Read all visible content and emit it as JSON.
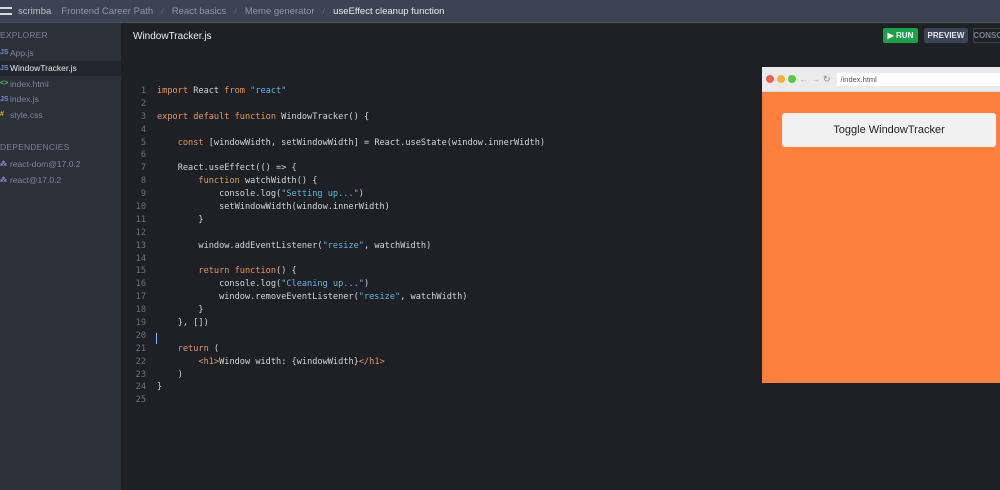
{
  "topbar": {
    "brand": "scrimba",
    "breadcrumbs": [
      "Frontend Career Path",
      "React basics",
      "Meme generator",
      "useEffect cleanup function"
    ]
  },
  "sidebar": {
    "explorer_label": "EXPLORER",
    "files": [
      {
        "name": "App.js",
        "icon": "JS",
        "type": "js",
        "active": false
      },
      {
        "name": "WindowTracker.js",
        "icon": "JS",
        "type": "js",
        "active": true
      },
      {
        "name": "index.html",
        "icon": "<>",
        "type": "html",
        "active": false
      },
      {
        "name": "index.js",
        "icon": "JS",
        "type": "js",
        "active": false
      },
      {
        "name": "style.css",
        "icon": "#",
        "type": "css",
        "active": false
      }
    ],
    "dependencies_label": "DEPENDENCIES",
    "dependencies": [
      "react-dom@17.0.2",
      "react@17.0.2"
    ]
  },
  "editor": {
    "file_title": "WindowTracker.js",
    "lines": [
      [
        [
          "kw",
          "import"
        ],
        [
          "tx",
          " React "
        ],
        [
          "kw",
          "from"
        ],
        [
          "tx",
          " "
        ],
        [
          "st",
          "\"react\""
        ]
      ],
      [],
      [
        [
          "kw",
          "export default function"
        ],
        [
          "tx",
          " WindowTracker() {"
        ]
      ],
      [],
      [
        [
          "tx",
          "    "
        ],
        [
          "kw",
          "const"
        ],
        [
          "tx",
          " [windowWidth, setWindowWidth] = React.useState(window.innerWidth)"
        ]
      ],
      [],
      [
        [
          "tx",
          "    React.useEffect(() => {"
        ]
      ],
      [
        [
          "tx",
          "        "
        ],
        [
          "kw",
          "function"
        ],
        [
          "tx",
          " watchWidth() {"
        ]
      ],
      [
        [
          "tx",
          "            console.log("
        ],
        [
          "st",
          "\"Setting up...\""
        ],
        [
          "tx",
          ")"
        ]
      ],
      [
        [
          "tx",
          "            setWindowWidth(window.innerWidth)"
        ]
      ],
      [
        [
          "tx",
          "        }"
        ]
      ],
      [],
      [
        [
          "tx",
          "        window.addEventListener("
        ],
        [
          "st",
          "\"resize\""
        ],
        [
          "tx",
          ", watchWidth)"
        ]
      ],
      [],
      [
        [
          "tx",
          "        "
        ],
        [
          "kw",
          "return function"
        ],
        [
          "tx",
          "() {"
        ]
      ],
      [
        [
          "tx",
          "            console.log("
        ],
        [
          "st",
          "\"Cleaning up...\""
        ],
        [
          "tx",
          ")"
        ]
      ],
      [
        [
          "tx",
          "            window.removeEventListener("
        ],
        [
          "st",
          "\"resize\""
        ],
        [
          "tx",
          ", watchWidth)"
        ]
      ],
      [
        [
          "tx",
          "        }"
        ]
      ],
      [
        [
          "tx",
          "    }, [])"
        ]
      ],
      [],
      [
        [
          "tx",
          "    "
        ],
        [
          "kw",
          "return"
        ],
        [
          "tx",
          " ("
        ]
      ],
      [
        [
          "tx",
          "        "
        ],
        [
          "kw",
          "<h1>"
        ],
        [
          "tx",
          "Window width: {windowWidth}"
        ],
        [
          "kw",
          "</h1>"
        ]
      ],
      [
        [
          "tx",
          "    )"
        ]
      ],
      [
        [
          "tx",
          "}"
        ]
      ],
      []
    ]
  },
  "toolbar": {
    "run": "▶ RUN",
    "preview": "PREVIEW",
    "console": "CONSOLE"
  },
  "preview": {
    "url": "/index.html",
    "back": "←",
    "forward": "→",
    "reload": "↻",
    "toggle_button": "Toggle WindowTracker"
  },
  "colors": {
    "run": "#1aa14a",
    "preview_bg": "#ff7f3f"
  }
}
